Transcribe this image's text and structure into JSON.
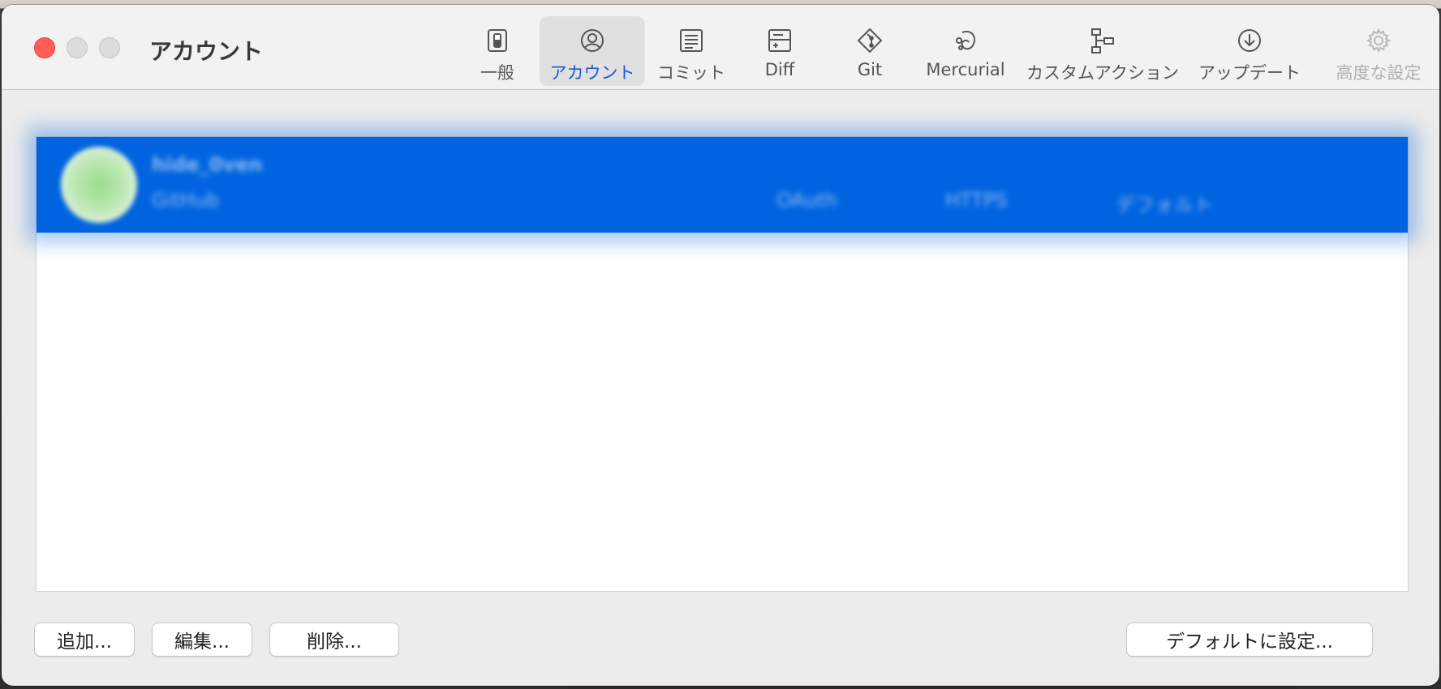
{
  "window": {
    "title": "アカウント"
  },
  "toolbar": {
    "items": [
      {
        "label": "一般",
        "icon": "switch-icon",
        "state": "normal"
      },
      {
        "label": "アカウント",
        "icon": "person-circle-icon",
        "state": "active"
      },
      {
        "label": "コミット",
        "icon": "document-lines-icon",
        "state": "normal"
      },
      {
        "label": "Diff",
        "icon": "diff-icon",
        "state": "normal"
      },
      {
        "label": "Git",
        "icon": "git-icon",
        "state": "normal"
      },
      {
        "label": "Mercurial",
        "icon": "mercurial-icon",
        "state": "normal"
      },
      {
        "label": "カスタムアクション",
        "icon": "flowchart-icon",
        "state": "normal"
      },
      {
        "label": "アップデート",
        "icon": "download-circle-icon",
        "state": "normal"
      },
      {
        "label": "高度な設定",
        "icon": "gear-icon",
        "state": "disabled"
      }
    ]
  },
  "accounts": {
    "selected": {
      "name": "hide_0ven",
      "host": "GitHub",
      "auth": "OAuth",
      "protocol": "HTTPS",
      "default_label": "デフォルト"
    }
  },
  "buttons": {
    "add": "追加...",
    "edit": "編集...",
    "delete": "削除...",
    "set_default": "デフォルトに設定..."
  },
  "colors": {
    "selection": "#0064e0",
    "accent_text": "#1a5ad8",
    "close": "#ff5f57"
  }
}
